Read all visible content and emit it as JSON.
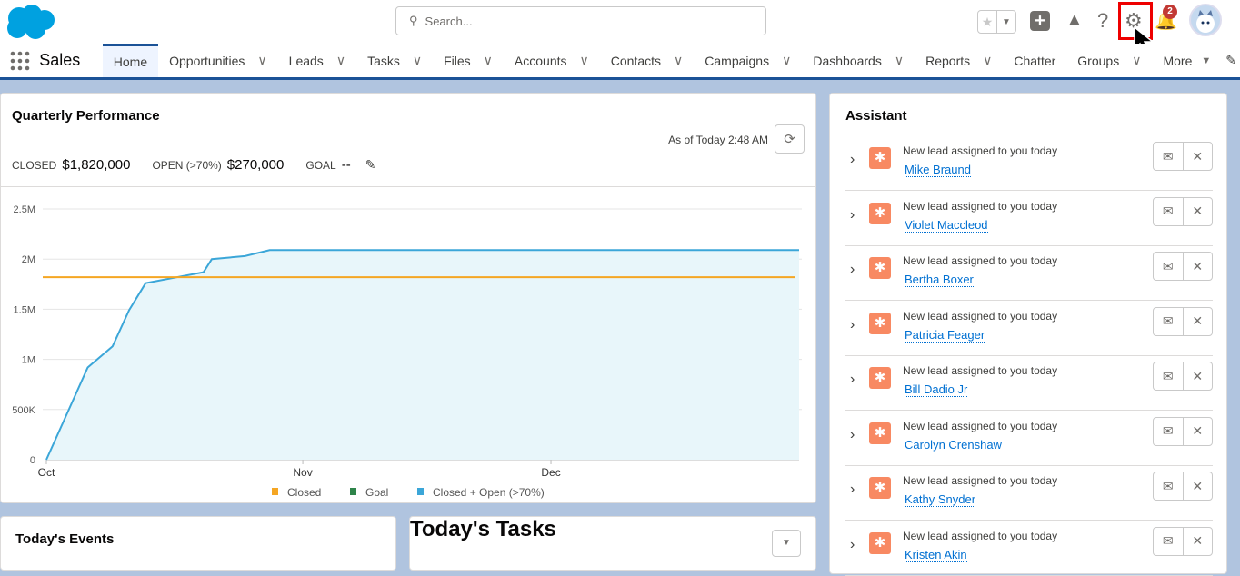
{
  "header": {
    "search_placeholder": "Search...",
    "notification_count": "2"
  },
  "nav": {
    "app_name": "Sales",
    "tabs": [
      {
        "label": "Home",
        "active": true,
        "dropdown": false
      },
      {
        "label": "Opportunities",
        "dropdown": true
      },
      {
        "label": "Leads",
        "dropdown": true
      },
      {
        "label": "Tasks",
        "dropdown": true
      },
      {
        "label": "Files",
        "dropdown": true
      },
      {
        "label": "Accounts",
        "dropdown": true
      },
      {
        "label": "Contacts",
        "dropdown": true
      },
      {
        "label": "Campaigns",
        "dropdown": true
      },
      {
        "label": "Dashboards",
        "dropdown": true
      },
      {
        "label": "Reports",
        "dropdown": true
      },
      {
        "label": "Chatter",
        "dropdown": false
      },
      {
        "label": "Groups",
        "dropdown": true
      }
    ],
    "more_label": "More"
  },
  "performance": {
    "title": "Quarterly Performance",
    "as_of": "As of Today 2:48 AM",
    "closed_label": "CLOSED",
    "closed_value": "$1,820,000",
    "open_label": "OPEN (>70%)",
    "open_value": "$270,000",
    "goal_label": "GOAL",
    "goal_value": "--"
  },
  "chart_data": {
    "type": "area",
    "title": "",
    "xlabel": "",
    "ylabel": "",
    "x_ticks": [
      {
        "label": "Oct",
        "day": 0
      },
      {
        "label": "Nov",
        "day": 31
      },
      {
        "label": "Dec",
        "day": 61
      }
    ],
    "x_range": [
      0,
      91
    ],
    "y_ticks": [
      {
        "label": "0",
        "value": 0
      },
      {
        "label": "500K",
        "value": 500000
      },
      {
        "label": "1M",
        "value": 1000000
      },
      {
        "label": "1.5M",
        "value": 1500000
      },
      {
        "label": "2M",
        "value": 2000000
      },
      {
        "label": "2.5M",
        "value": 2500000
      }
    ],
    "ylim": [
      0,
      2500000
    ],
    "legend": [
      {
        "name": "Closed",
        "color": "#f5a623"
      },
      {
        "name": "Goal",
        "color": "#2e844a"
      },
      {
        "name": "Closed + Open (>70%)",
        "color": "#3ba6d8"
      }
    ],
    "legend_position": "bottom",
    "series": [
      {
        "name": "Closed",
        "points": [
          [
            0,
            1820000
          ],
          [
            91,
            1820000
          ]
        ]
      },
      {
        "name": "Closed + Open (>70%)",
        "points": [
          [
            0,
            0
          ],
          [
            5,
            920000
          ],
          [
            8,
            1130000
          ],
          [
            10,
            1490000
          ],
          [
            12,
            1760000
          ],
          [
            19,
            1870000
          ],
          [
            20,
            2000000
          ],
          [
            24,
            2030000
          ],
          [
            27,
            2090000
          ],
          [
            91,
            2090000
          ]
        ]
      }
    ]
  },
  "assistant": {
    "title": "Assistant",
    "items": [
      {
        "message": "New lead assigned to you today",
        "name": "Mike Braund"
      },
      {
        "message": "New lead assigned to you today",
        "name": "Violet Maccleod"
      },
      {
        "message": "New lead assigned to you today",
        "name": "Bertha Boxer"
      },
      {
        "message": "New lead assigned to you today",
        "name": "Patricia Feager"
      },
      {
        "message": "New lead assigned to you today",
        "name": "Bill Dadio Jr"
      },
      {
        "message": "New lead assigned to you today",
        "name": "Carolyn Crenshaw"
      },
      {
        "message": "New lead assigned to you today",
        "name": "Kathy Snyder"
      },
      {
        "message": "New lead assigned to you today",
        "name": "Kristen Akin"
      }
    ]
  },
  "events": {
    "title": "Today's Events"
  },
  "tasks": {
    "title": "Today's Tasks"
  }
}
